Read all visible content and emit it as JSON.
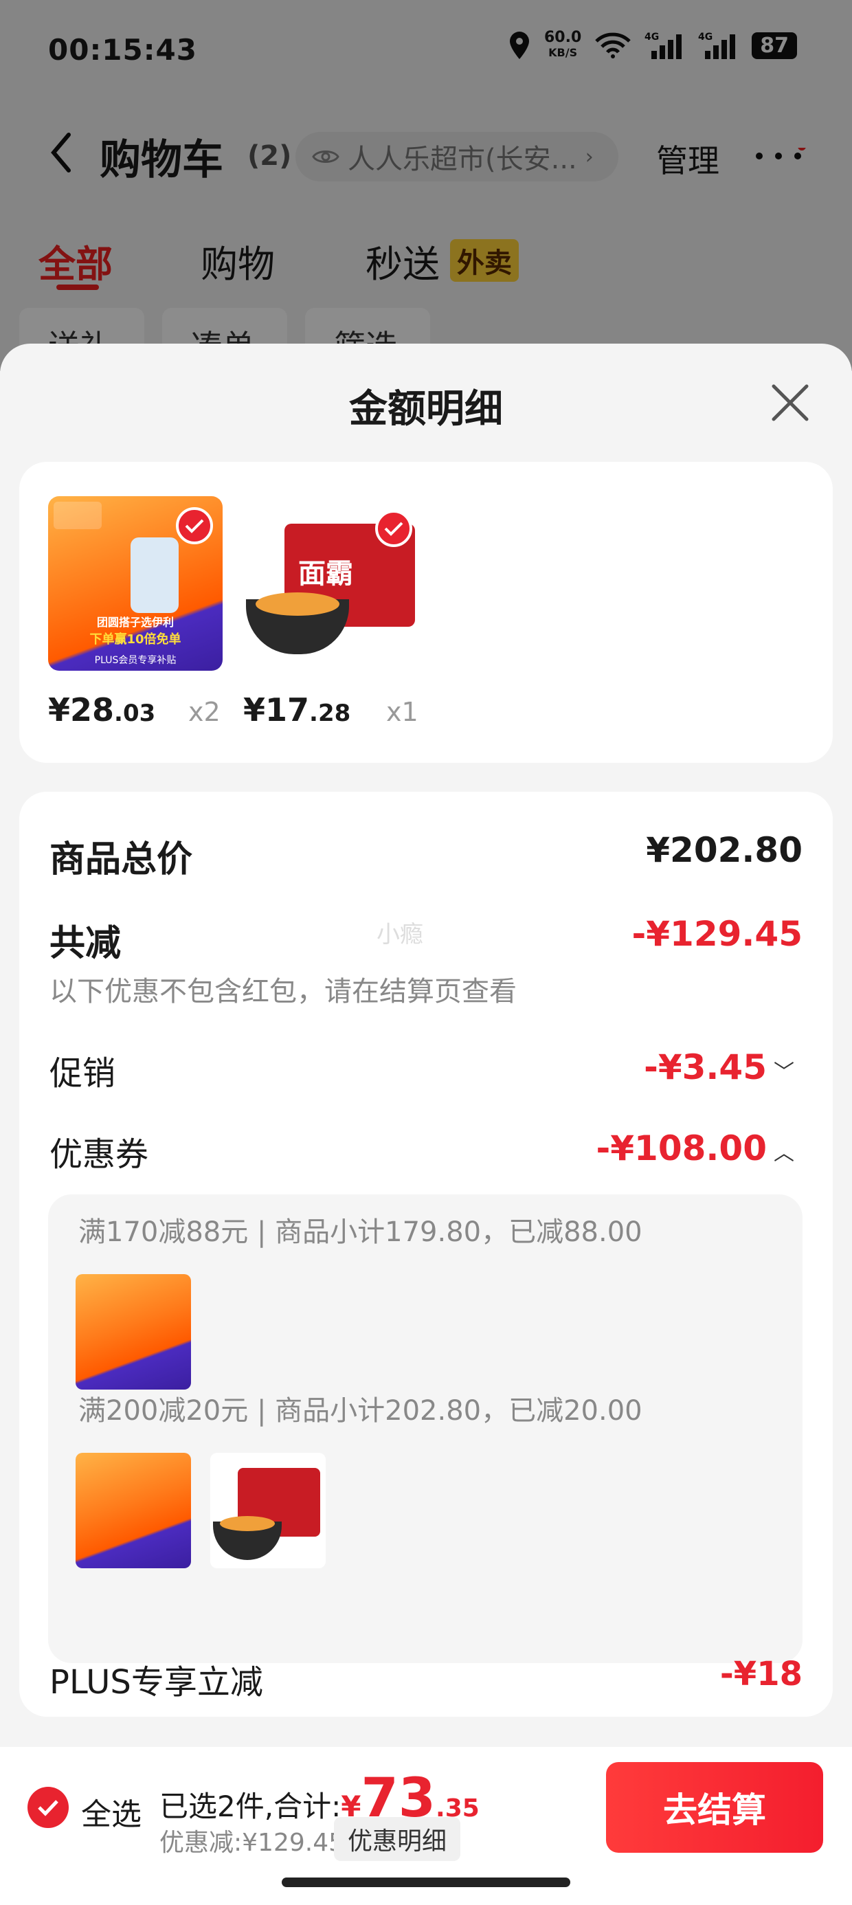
{
  "status_bar": {
    "time": "00:15:43",
    "speed_value": "60.0",
    "speed_unit": "KB/S",
    "battery": "87"
  },
  "nav": {
    "title": "购物车",
    "count": "(2)",
    "store": "人人乐超市(长安...",
    "manage": "管理"
  },
  "tabs": [
    {
      "label": "全部"
    },
    {
      "label": "购物"
    },
    {
      "label": "秒送"
    }
  ],
  "waimai_badge": "外卖",
  "chips": [
    "送礼",
    "凑单",
    "筛选"
  ],
  "sheet": {
    "title": "金额明细",
    "products": [
      {
        "price_main": "¥28",
        "price_dec": ".03",
        "qty": "x2"
      },
      {
        "price_main": "¥17",
        "price_dec": ".28",
        "qty": "x1"
      }
    ],
    "product1_banner": "团圆搭子选伊利",
    "product1_banner2": "下单赢10倍免单",
    "product1_footer": "PLUS会员专享补贴",
    "product2_brand": "面霸",
    "goods_total_label": "商品总价",
    "goods_total_value": "¥202.80",
    "watermark": "小瘾",
    "reduce_label": "共减",
    "reduce_value": "-¥129.45",
    "reduce_note": "以下优惠不包含红包，请在结算页查看",
    "promo_label": "促销",
    "promo_value": "-¥3.45",
    "coupon_label": "优惠券",
    "coupon_value": "-¥108.00",
    "coupon_rules": [
      "满170减88元 | 商品小计179.80，已减88.00",
      "满200减20元 | 商品小计202.80，已减20.00"
    ],
    "plus_label": "PLUS专享立减",
    "plus_value": "-¥18"
  },
  "bottom_bar": {
    "select_all": "全选",
    "selected_text": "已选2件,合计:",
    "yen": "¥",
    "total_main": "73",
    "total_dec": ".35",
    "discount_text": "优惠减:¥129.45",
    "detail_button": "优惠明细",
    "checkout_button": "去结算"
  },
  "colors": {
    "accent": "#e8232f",
    "badge": "#ffd23a"
  }
}
